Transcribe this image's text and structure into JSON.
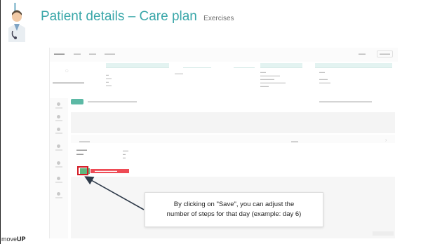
{
  "slide": {
    "title": "Patient details – Care plan",
    "subtitle": "Exercises",
    "callout_line1": "By clicking on \"Save\", you can adjust the",
    "callout_line2": "number of steps for that day (example: day 6)",
    "logo_prefix": "move",
    "logo_suffix": "UP"
  },
  "colors": {
    "title": "#3aa7a9",
    "highlight": "#d31b25",
    "steps_bar": "#ee4b55",
    "save_button": "#5fb87f",
    "active_tab": "#5cb9a5",
    "arrow": "#2f3b4a"
  }
}
